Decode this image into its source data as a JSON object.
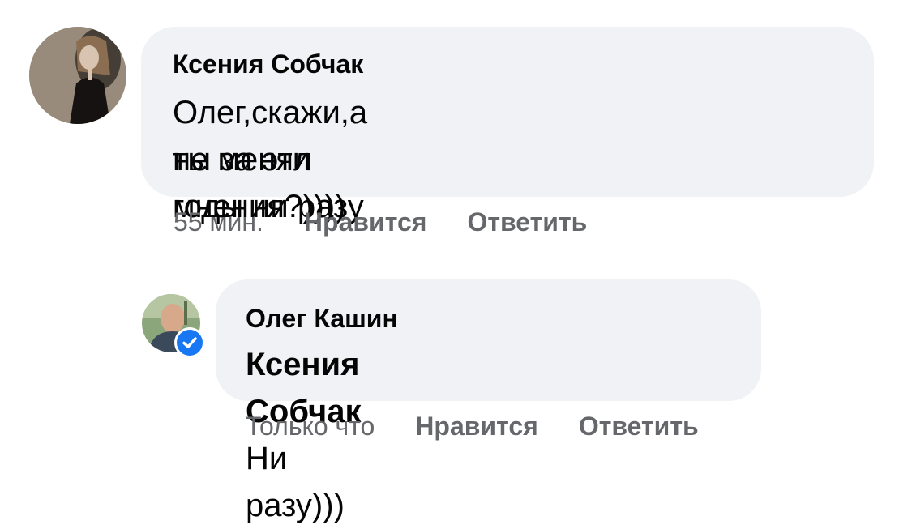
{
  "comments": [
    {
      "author": "Ксения Собчак",
      "text_line1": "Олег,скажи,а ты за эти годы ни разу",
      "text_line2": "не менял мнения?))))",
      "time": "55 мин.",
      "like_label": "Нравится",
      "reply_label": "Ответить"
    },
    {
      "author": "Олег Кашин",
      "mention": "Ксения Собчак",
      "text": " Ни разу)))",
      "time": "Только что",
      "like_label": "Нравится",
      "reply_label": "Ответить",
      "verified": true
    }
  ],
  "colors": {
    "bubble": "#f0f2f5",
    "meta_text": "#65676b",
    "verified_badge": "#1877f2"
  },
  "icons": [
    "avatar-ksenia",
    "avatar-oleg",
    "verified-check-icon"
  ]
}
